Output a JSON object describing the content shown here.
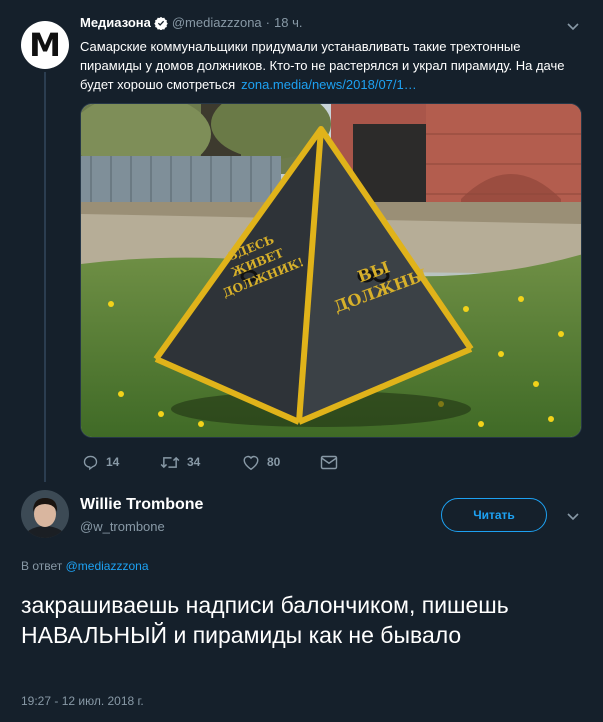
{
  "tweet": {
    "avatar_letter": "M",
    "author_name": "Медиазона",
    "author_handle": "@mediazzzona",
    "dot": "·",
    "time": "18 ч.",
    "text": "Самарские коммунальщики придумали устанавливать такие трехтонные пирамиды у домов должников. Кто-то не растерялся и украл пирамиду. На даче будет хорошо смотреться",
    "link": "zona.media/news/2018/07/1…",
    "photo": {
      "sign_left": [
        "ЗДЕСЬ",
        "ЖИВЕТ",
        "ДОЛЖНИК!"
      ],
      "sign_right": [
        "ВЫ",
        "ДОЛЖНЫ"
      ]
    },
    "actions": {
      "reply_icon": "reply-icon",
      "reply_count": "14",
      "retweet_icon": "retweet-icon",
      "retweet_count": "34",
      "like_icon": "heart-icon",
      "like_count": "80",
      "dm_icon": "envelope-icon"
    }
  },
  "reply": {
    "author_name": "Willie Trombone",
    "author_handle": "@w_trombone",
    "follow_label": "Читать",
    "reply_to_prefix": "В ответ",
    "reply_to_handle": "@mediazzzona",
    "text": "закрашиваешь надписи балончиком, пишешь НАВАЛЬНЫЙ и пирамиды как не бывало",
    "timestamp": "19:27 - 12 июл. 2018 г."
  },
  "colors": {
    "background": "#15202b",
    "accent": "#1da1f2",
    "muted": "#8899a6",
    "text": "#ffffff"
  }
}
